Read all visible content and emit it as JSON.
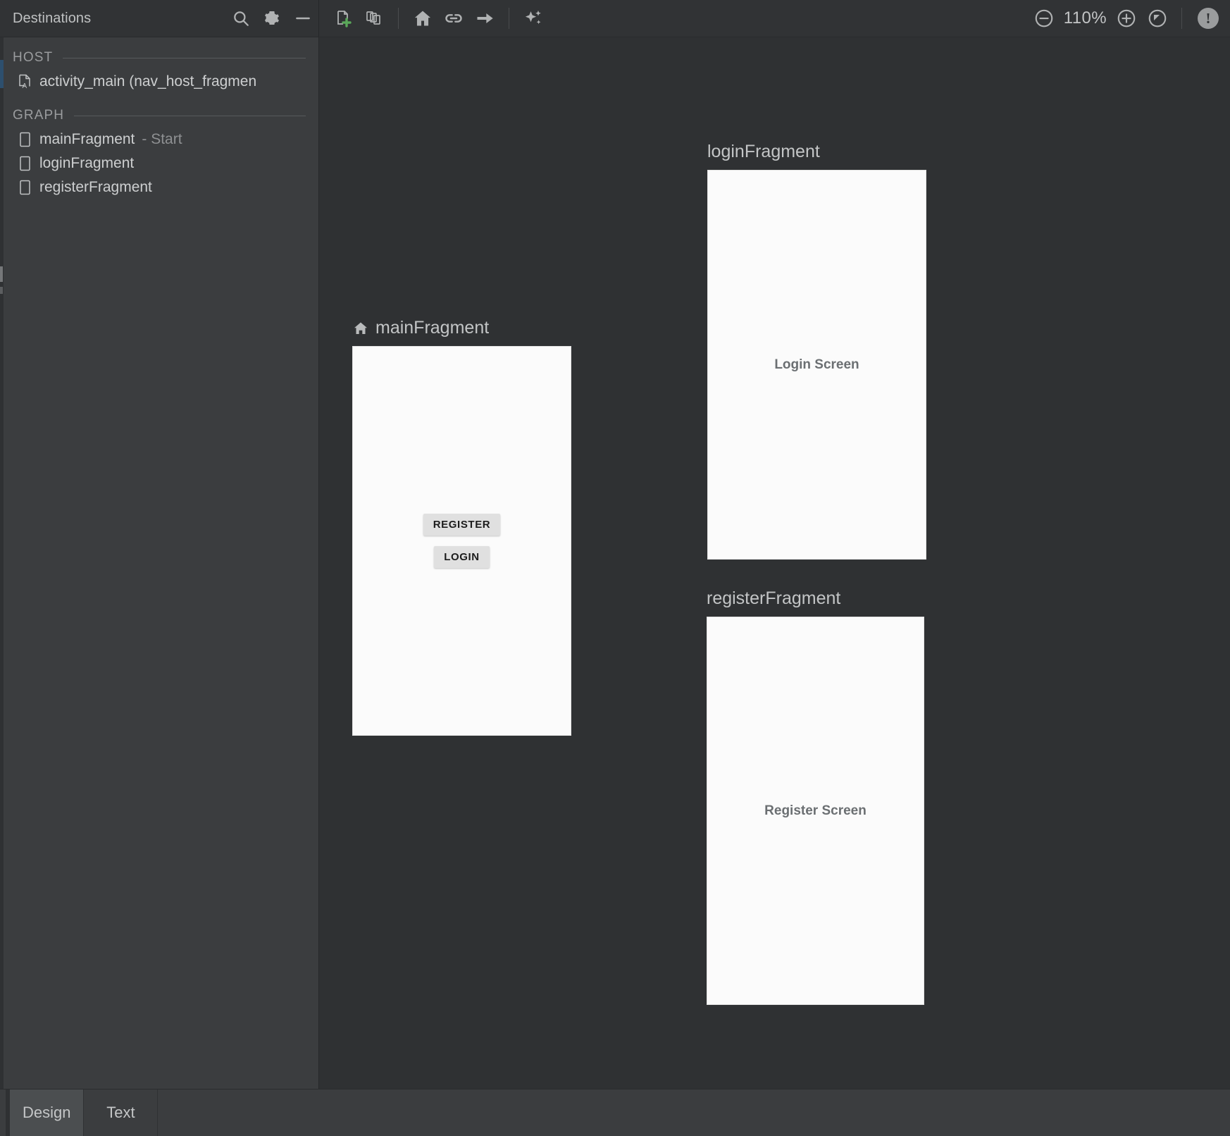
{
  "toolbar": {
    "panel_title": "Destinations",
    "icons": [
      {
        "name": "search-icon",
        "label": "Search"
      },
      {
        "name": "gear-icon",
        "label": "Settings"
      },
      {
        "name": "minimize-icon",
        "label": "Hide"
      },
      {
        "name": "new-destination-icon",
        "label": "New Destination"
      },
      {
        "name": "new-nested-graph-icon",
        "label": "New Nested Graph"
      },
      {
        "name": "home-icon",
        "label": "Set Start Destination"
      },
      {
        "name": "link-icon",
        "label": "Add Deep Link"
      },
      {
        "name": "arrow-icon",
        "label": "Add Action"
      },
      {
        "name": "sparkle-icon",
        "label": "Auto Arrange"
      }
    ],
    "zoom_out_label": "Zoom out",
    "zoom_level": "110%",
    "zoom_in_label": "Zoom in",
    "zoom_fit_label": "Zoom to fit",
    "issue_badge": "!",
    "accent_green": "#5aa85a"
  },
  "sidebar": {
    "sections": [
      {
        "title": "HOST",
        "items": [
          {
            "icon": "layout-file-icon",
            "name": "activity_main (nav_host_fragmen",
            "suffix": ""
          }
        ]
      },
      {
        "title": "GRAPH",
        "items": [
          {
            "icon": "fragment-icon",
            "name": "mainFragment",
            "suffix": "- Start"
          },
          {
            "icon": "fragment-icon",
            "name": "loginFragment",
            "suffix": ""
          },
          {
            "icon": "fragment-icon",
            "name": "registerFragment",
            "suffix": ""
          }
        ]
      }
    ]
  },
  "canvas": {
    "destinations": [
      {
        "id": "main",
        "label": "mainFragment",
        "is_start": true,
        "screen_text": "",
        "buttons": [
          "REGISTER",
          "LOGIN"
        ]
      },
      {
        "id": "login",
        "label": "loginFragment",
        "is_start": false,
        "screen_text": "Login Screen",
        "buttons": []
      },
      {
        "id": "register",
        "label": "registerFragment",
        "is_start": false,
        "screen_text": "Register Screen",
        "buttons": []
      }
    ]
  },
  "bottom_tabs": [
    {
      "label": "Design",
      "active": true
    },
    {
      "label": "Text",
      "active": false
    }
  ]
}
